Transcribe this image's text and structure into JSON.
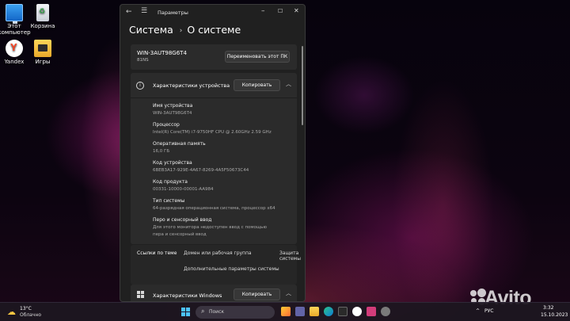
{
  "desktop": {
    "icons": [
      {
        "label": "Этот компьютер",
        "icon": "computer-icon"
      },
      {
        "label": "Корзина",
        "icon": "recycle-bin-icon"
      },
      {
        "label": "Yandex",
        "icon": "yandex-browser-icon"
      },
      {
        "label": "Игры",
        "icon": "games-folder-icon"
      }
    ]
  },
  "window": {
    "title": "Параметры",
    "breadcrumb": {
      "parent": "Система",
      "current": "О системе"
    },
    "pc": {
      "name": "WIN-3AUT98G6T4",
      "subtitle": "81NS",
      "rename_button": "Переименовать этот ПК"
    },
    "device_specs": {
      "title": "Характеристики устройства",
      "copy_button": "Копировать",
      "rows": [
        {
          "label": "Имя устройства",
          "value": "WIN-3AUT98G6T4"
        },
        {
          "label": "Процессор",
          "value": "Intel(R) Core(TM) i7-9750HF CPU @ 2.60GHz   2.59 GHz"
        },
        {
          "label": "Оперативная память",
          "value": "16,0 ГБ"
        },
        {
          "label": "Код устройства",
          "value": "6BEB3A17-929E-4A67-8269-4A5F50673C44"
        },
        {
          "label": "Код продукта",
          "value": "00331-10000-00001-AA984"
        },
        {
          "label": "Тип системы",
          "value": "64-разрядная операционная система, процессор x64"
        },
        {
          "label": "Перо и сенсорный ввод",
          "value": "Для этого монитора недоступен ввод с помощью",
          "value2": "пера и сенсорный ввод"
        }
      ]
    },
    "related_links": {
      "label": "Ссылки по теме",
      "domain": "Домен или рабочая группа",
      "protection": "Защита системы",
      "advanced": "Дополнительные параметры системы"
    },
    "windows_specs": {
      "title": "Характеристики Windows",
      "copy_button": "Копировать"
    }
  },
  "taskbar": {
    "weather": {
      "temp": "13°C",
      "condition": "Облачно"
    },
    "search_placeholder": "Поиск",
    "language": "РУС",
    "time": "3:32",
    "date": "15.10.2023"
  },
  "watermark": "Avito",
  "colors": {
    "window_bg": "#202020",
    "card_bg": "#2b2b2b",
    "accent": "#4cc2ff"
  }
}
